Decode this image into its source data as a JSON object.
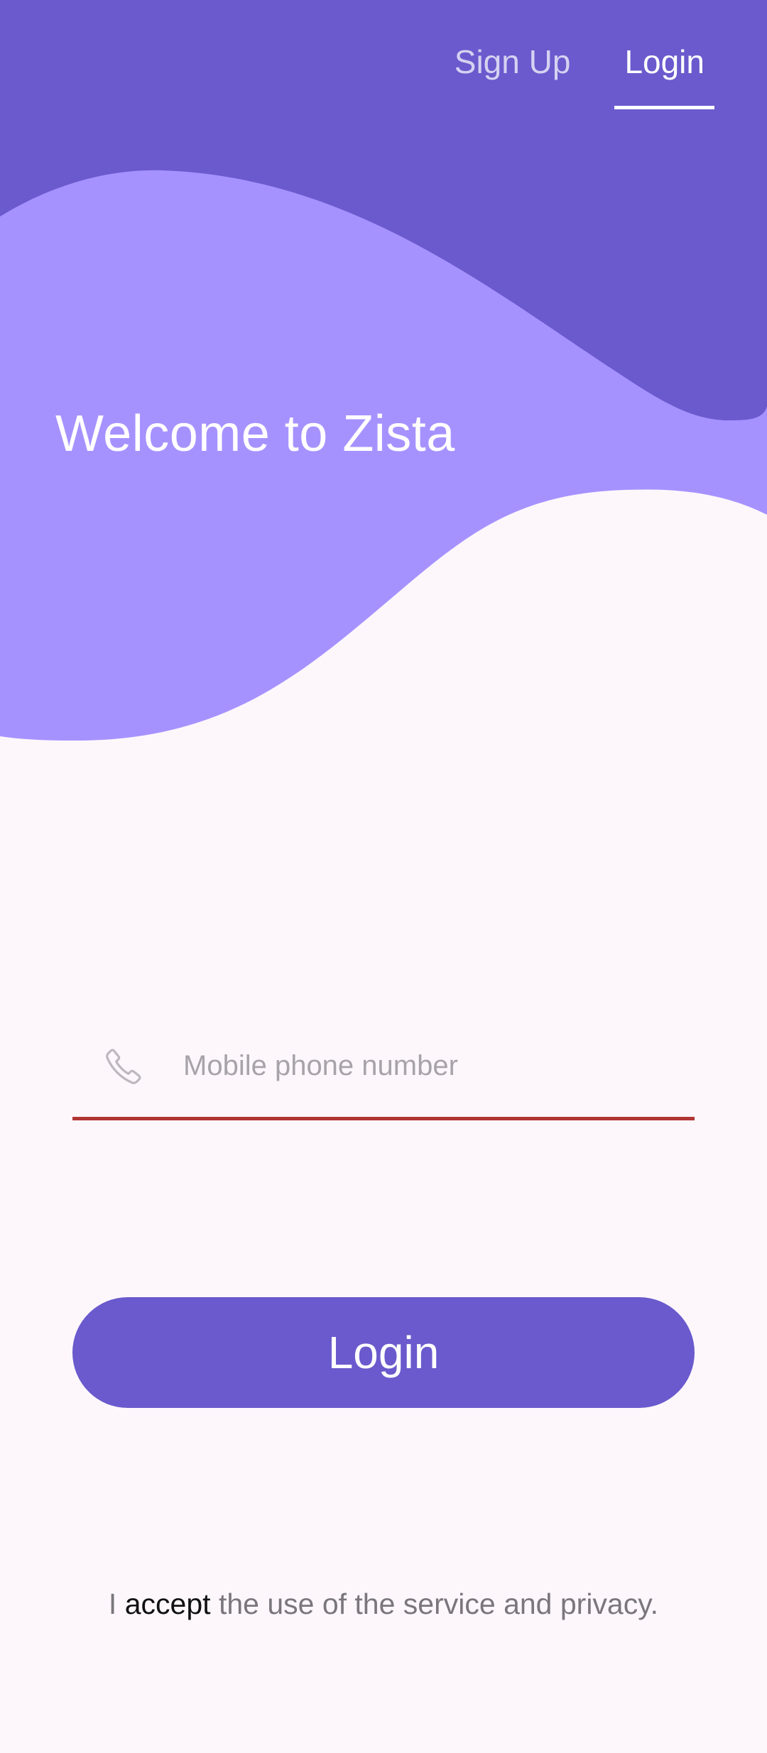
{
  "colors": {
    "primary": "#6a5acd",
    "wave_light": "#a692ff",
    "background": "#fdf7fc",
    "field_underline": "#b23535"
  },
  "tabs": [
    {
      "label": "Sign Up",
      "active": false
    },
    {
      "label": "Login",
      "active": true
    }
  ],
  "header": {
    "title": "Welcome to Zista"
  },
  "form": {
    "phone_icon": "phone-icon",
    "phone_placeholder": "Mobile phone number",
    "phone_value": ""
  },
  "login_button": {
    "label": "Login"
  },
  "terms": {
    "prefix": "I",
    "link": "accept",
    "suffix": "the use of the service and privacy."
  }
}
